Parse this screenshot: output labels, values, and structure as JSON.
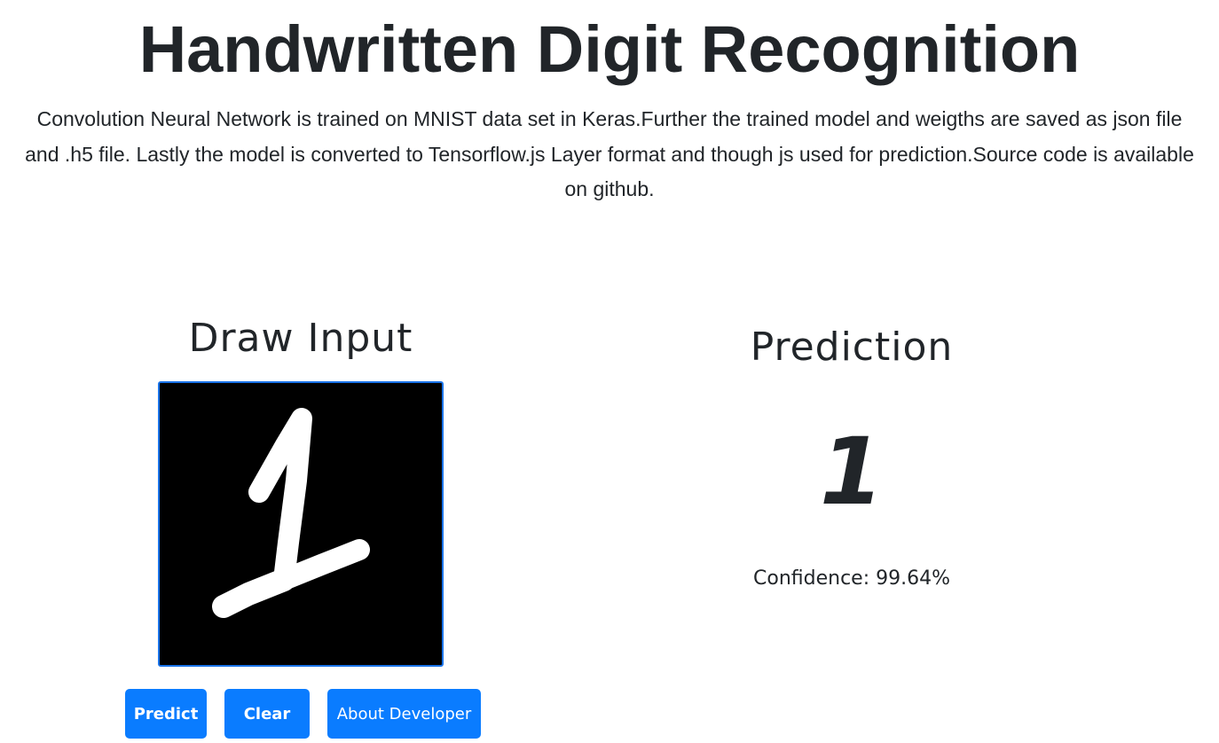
{
  "header": {
    "title": "Handwritten Digit Recognition",
    "description": "Convolution Neural Network is trained on MNIST data set in Keras.Further the trained model and weigths are saved as json file and .h5 file. Lastly the model is converted to Tensorflow.js Layer format and though js used for prediction.Source code is available on github."
  },
  "input_panel": {
    "heading": "Draw Input",
    "canvas_background": "#000000",
    "stroke_color": "#ffffff",
    "buttons": {
      "predict_label": "Predict",
      "clear_label": "Clear",
      "about_label": "About Developer"
    }
  },
  "prediction_panel": {
    "heading": "Prediction",
    "digit": "1",
    "confidence_label": "Confidence:",
    "confidence_value": "99.64%"
  },
  "colors": {
    "button_primary": "#0a7cff",
    "text_primary": "#212529",
    "canvas_border": "#1a73e8"
  }
}
